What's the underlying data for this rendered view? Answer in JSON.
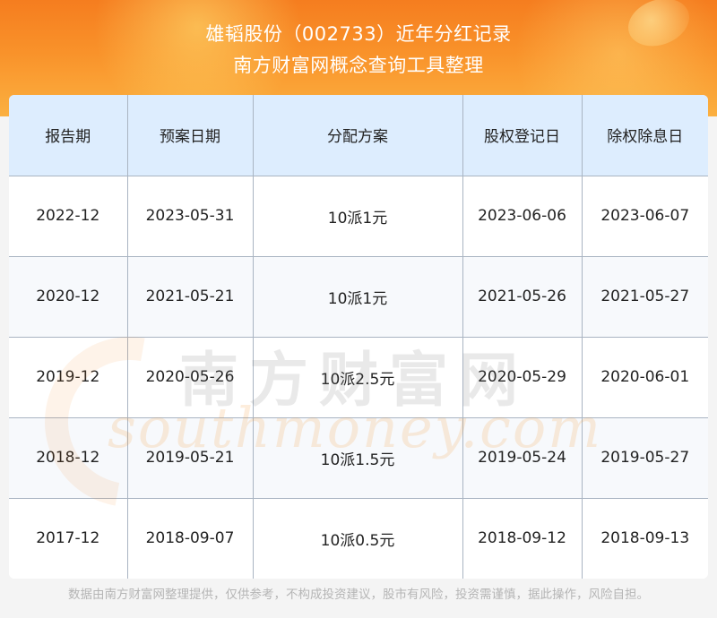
{
  "header": {
    "title_line1": "雄韬股份（002733）近年分红记录",
    "title_line2": "南方财富网概念查询工具整理"
  },
  "table": {
    "columns": [
      "报告期",
      "预案日期",
      "分配方案",
      "股权登记日",
      "除权除息日"
    ],
    "rows": [
      [
        "2022-12",
        "2023-05-31",
        "10派1元",
        "2023-06-06",
        "2023-06-07"
      ],
      [
        "2020-12",
        "2021-05-21",
        "10派1元",
        "2021-05-26",
        "2021-05-27"
      ],
      [
        "2019-12",
        "2020-05-26",
        "10派2.5元",
        "2020-05-29",
        "2020-06-01"
      ],
      [
        "2018-12",
        "2019-05-21",
        "10派1.5元",
        "2019-05-24",
        "2019-05-27"
      ],
      [
        "2017-12",
        "2018-09-07",
        "10派0.5元",
        "2018-09-12",
        "2018-09-13"
      ]
    ]
  },
  "watermark": {
    "cn": "南方财富网",
    "en": "southmoney.com"
  },
  "footer": {
    "disclaimer": "数据由南方财富网整理提供，仅供参考，不构成投资建议，股市有风险，投资需谨慎，据此操作，风险自担。"
  },
  "colors": {
    "banner_orange": "#f57d1f",
    "header_row_blue": "#ddedfe",
    "grid_line": "#a9b4c2"
  }
}
